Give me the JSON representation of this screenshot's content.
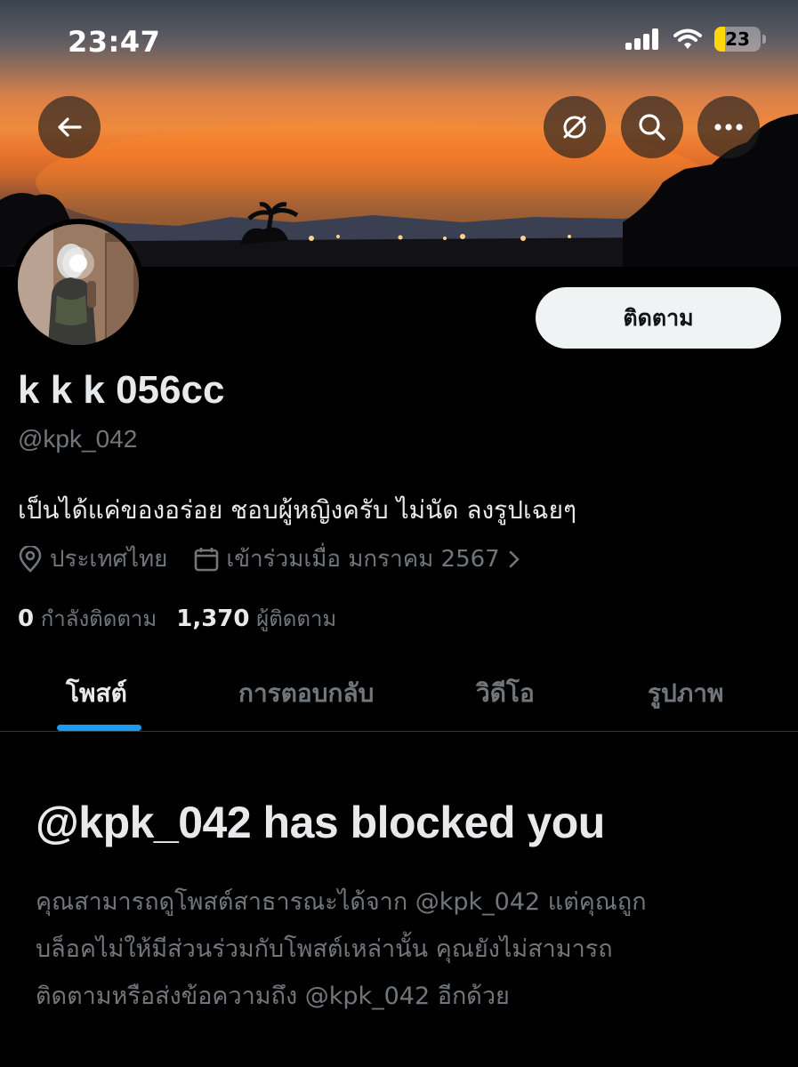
{
  "status_bar": {
    "time": "23:47",
    "battery": "23",
    "battery_color": "#ffd60a",
    "icons": [
      "signal-icon",
      "wifi-icon",
      "battery-icon"
    ]
  },
  "header": {
    "icons": [
      "back-arrow-icon",
      "translate-off-icon",
      "search-icon",
      "more-icon"
    ]
  },
  "profile": {
    "follow_label": "ติดตาม",
    "display_name": "k k k 056cc",
    "handle": "@kpk_042",
    "bio": "เป็นได้แค่ของอร่อย ชอบผู้หญิงครับ ไม่นัด ลงรูปเฉยๆ",
    "location": "ประเทศไทย",
    "joined": "เข้าร่วมเมื่อ มกราคม 2567",
    "following_count": "0",
    "following_label": "กำลังติดตาม",
    "followers_count": "1,370",
    "followers_label": "ผู้ติดตาม"
  },
  "tabs": [
    {
      "label": "โพสต์",
      "active": true
    },
    {
      "label": "การตอบกลับ",
      "active": false
    },
    {
      "label": "วิดีโอ",
      "active": false
    },
    {
      "label": "รูปภาพ",
      "active": false
    }
  ],
  "blocked": {
    "title": "@kpk_042 has blocked you",
    "line1": "คุณสามารถดูโพสต์สาธารณะได้จาก @kpk_042 แต่คุณถูก",
    "line2": "บล็อคไม่ให้มีส่วนร่วมกับโพสต์เหล่านั้น คุณยังไม่สามารถ",
    "line3": "ติดตามหรือส่งข้อความถึง @kpk_042 อีกด้วย"
  },
  "colors": {
    "accent": "#1d9bf0",
    "background": "#000000",
    "text_primary": "#e7e9ea",
    "text_secondary": "#71767b"
  }
}
